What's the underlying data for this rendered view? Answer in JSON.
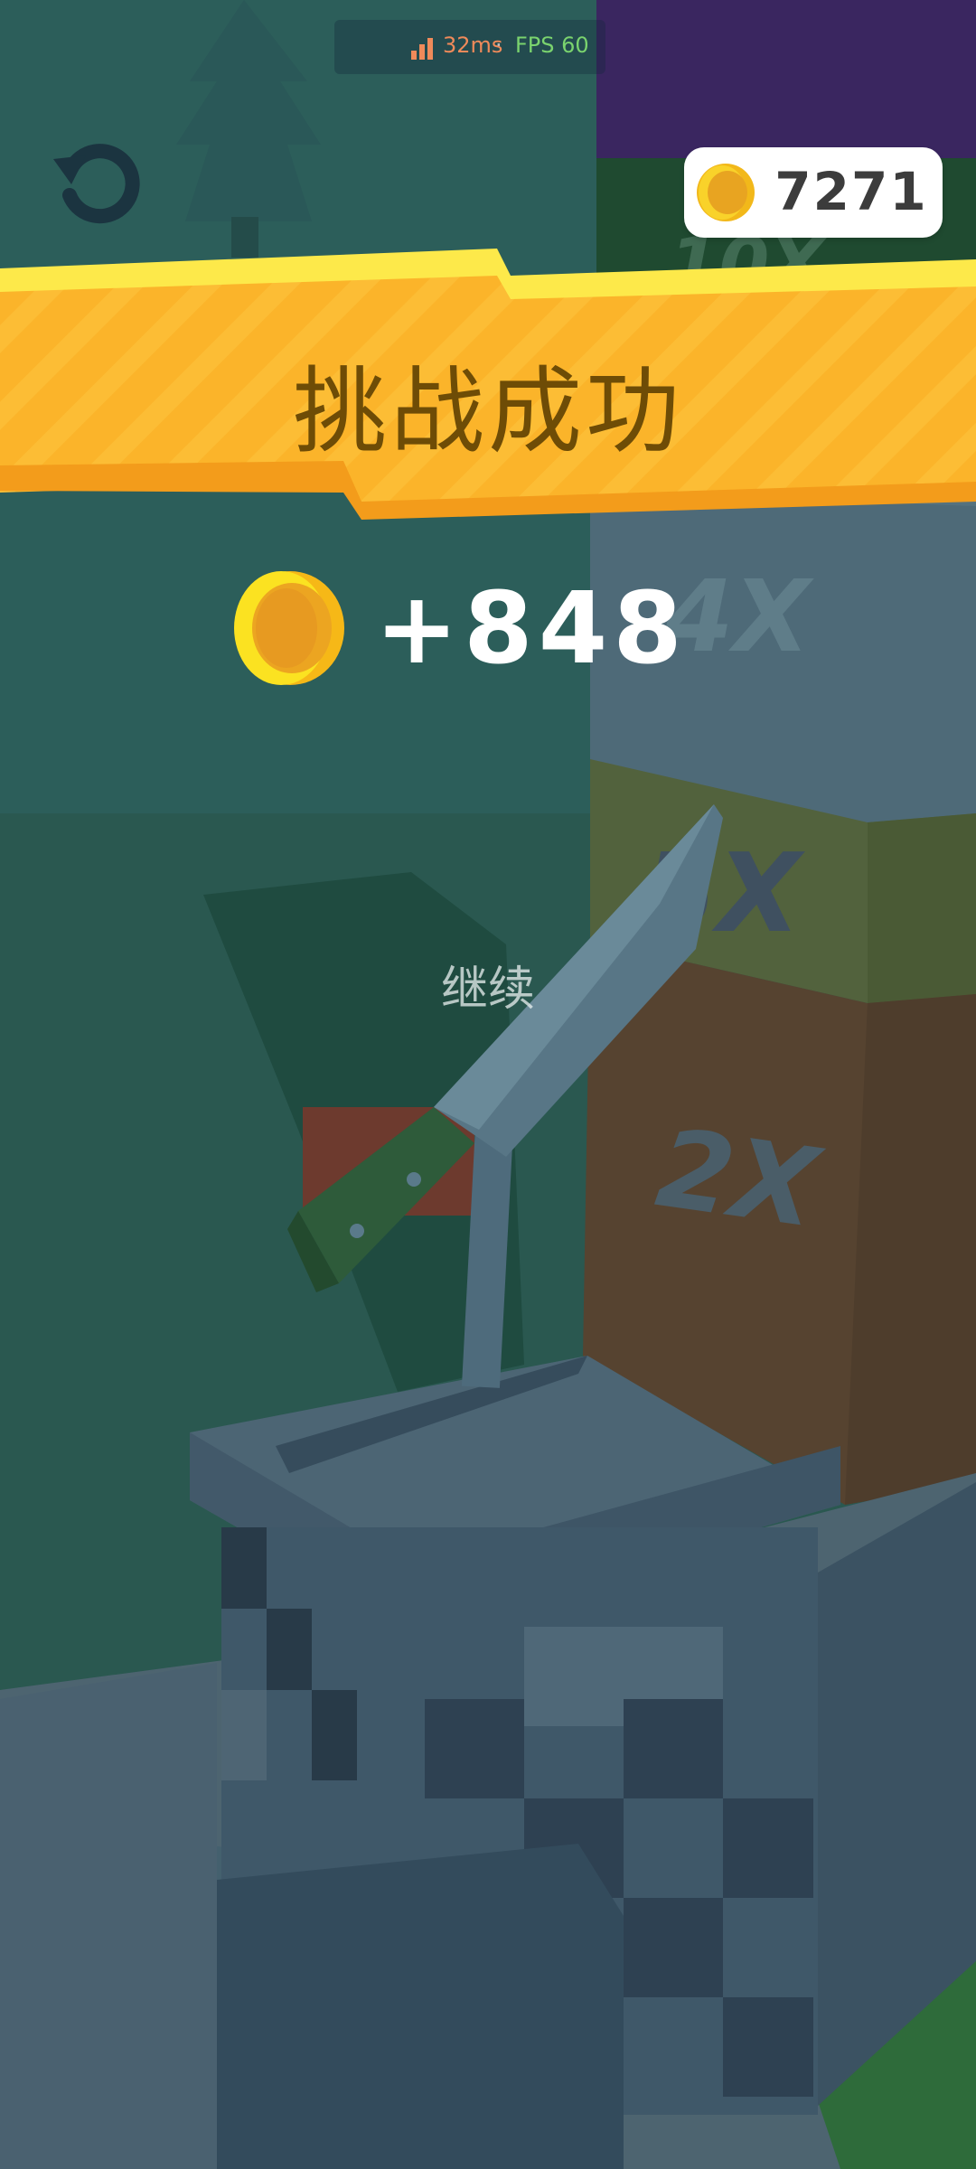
{
  "status": {
    "ping": "32ms",
    "separator": "·",
    "fps": "FPS 60"
  },
  "hud": {
    "coin_total": "7271",
    "coin_icon": "gold-coin-icon",
    "restart_icon": "restart-arrow-icon"
  },
  "result": {
    "title": "挑战成功",
    "reward": "+848",
    "continue_label": "继续"
  },
  "targets": [
    {
      "label": "10X",
      "color": "#1f4a30"
    },
    {
      "label": "4X",
      "color": "#4e6a78"
    },
    {
      "label": "5X",
      "color": "#52623d"
    },
    {
      "label": "2X",
      "color": "#564330"
    }
  ],
  "colors": {
    "banner": "#fbb42a",
    "banner_edge": "#fde94a",
    "coin": "#f6c21c",
    "title_text": "#6e4c06"
  }
}
